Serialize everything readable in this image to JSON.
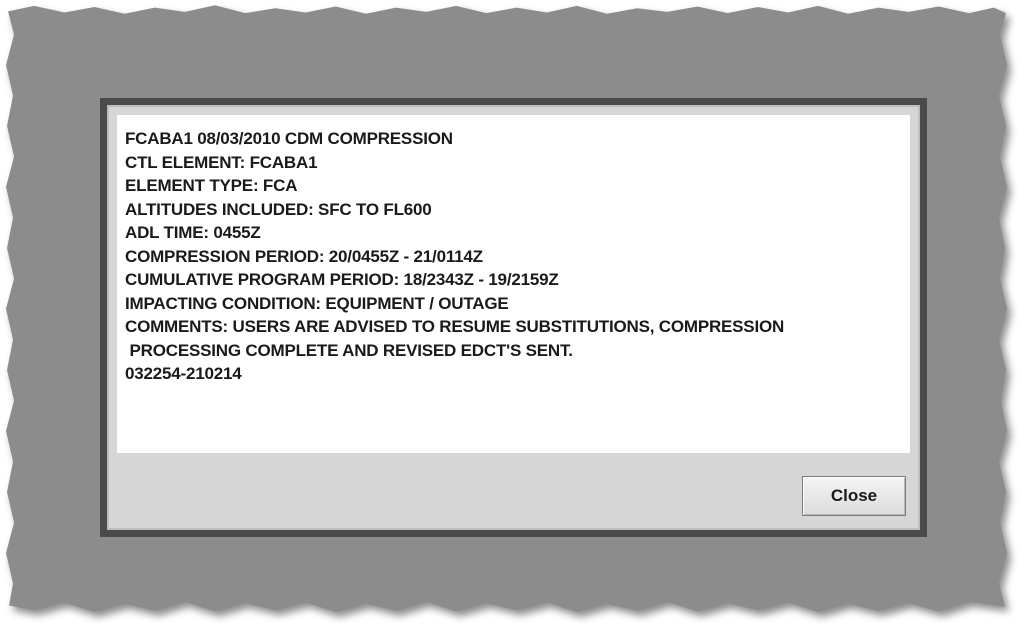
{
  "dialog": {
    "message_lines": [
      "FCABA1 08/03/2010 CDM COMPRESSION",
      "CTL ELEMENT: FCABA1",
      "ELEMENT TYPE: FCA",
      "ALTITUDES INCLUDED: SFC TO FL600",
      "ADL TIME: 0455Z",
      "COMPRESSION PERIOD: 20/0455Z - 21/0114Z",
      "CUMULATIVE PROGRAM PERIOD: 18/2343Z - 19/2159Z",
      "IMPACTING CONDITION: EQUIPMENT / OUTAGE",
      "COMMENTS: USERS ARE ADVISED TO RESUME SUBSTITUTIONS, COMPRESSION",
      " PROCESSING COMPLETE AND REVISED EDCT'S SENT.",
      "032254-210214"
    ],
    "close_label": "Close"
  }
}
